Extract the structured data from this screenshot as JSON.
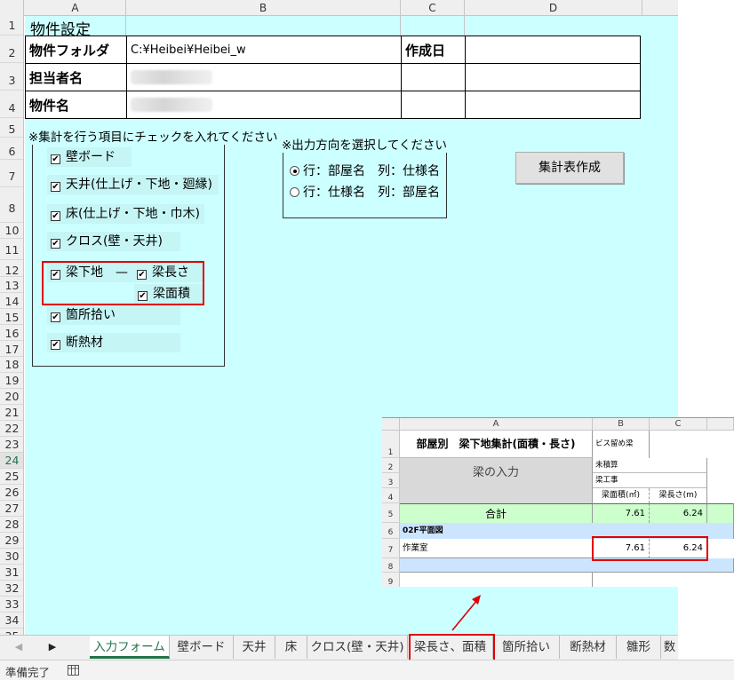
{
  "columns": [
    "A",
    "B",
    "C",
    "D"
  ],
  "rows": [
    "1",
    "2",
    "3",
    "4",
    "5",
    "6",
    "7",
    "8",
    "10",
    "11",
    "12",
    "13",
    "14",
    "15",
    "16",
    "17",
    "18",
    "19",
    "20",
    "21",
    "22",
    "23",
    "24",
    "25",
    "26",
    "27",
    "28",
    "29",
    "30",
    "31",
    "32",
    "33",
    "34",
    "35"
  ],
  "selected_row": "24",
  "sheet": {
    "title": "物件設定",
    "info": {
      "folder_label": "物件フォルダ",
      "folder_value": "C:¥Heibei¥Heibei_w",
      "created_label": "作成日",
      "person_label": "担当者名",
      "property_label": "物件名"
    },
    "checks": {
      "title": "※集計を行う項目にチェックを入れてください",
      "items": [
        "壁ボード",
        "天井(仕上げ・下地・廻縁)",
        "床(仕上げ・下地・巾木)",
        "クロス(壁・天井)",
        "梁下地",
        "梁長さ",
        "梁面積",
        "箇所拾い",
        "断熱材"
      ],
      "dash": "—",
      "mark": "✔"
    },
    "output": {
      "title": "※出力方向を選択してください",
      "options": [
        "行：部屋名　列：仕様名",
        "行：仕様名　列：部屋名"
      ]
    },
    "button_label": "集計表作成"
  },
  "excerpt": {
    "columns": [
      "A",
      "B",
      "C"
    ],
    "rows": [
      "1",
      "2",
      "3",
      "4",
      "5",
      "6",
      "7",
      "8",
      "9"
    ],
    "title": "部屋別　梁下地集計(面積・長さ)",
    "spec_name": "ビス留め梁",
    "input_label": "梁の入力",
    "status1": "未積算",
    "status2": "梁工事",
    "hdr_area": "梁面積(㎡)",
    "hdr_len": "梁長さ(m)",
    "total_label": "合計",
    "total_area": "7.61",
    "total_len": "6.24",
    "section": "02F平面図",
    "room": "作業室",
    "room_area": "7.61",
    "room_len": "6.24"
  },
  "tabs": [
    "入力フォーム",
    "壁ボード",
    "天井",
    "床",
    "クロス(壁・天井)",
    "梁長さ、面積",
    "箇所拾い",
    "断熱材",
    "雛形",
    "数"
  ],
  "active_tab": "入力フォーム",
  "status": "準備完了",
  "colors": {
    "sheet_bg": "#ccffff",
    "accent": "#217346",
    "highlight": "#e00000",
    "total_row": "#ccffcc",
    "section_row": "#cce5ff"
  }
}
